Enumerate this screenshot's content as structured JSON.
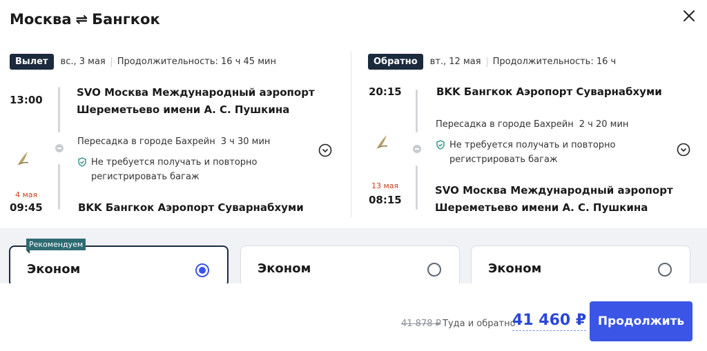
{
  "header": {
    "from": "Москва",
    "arrows": "⇌",
    "to": "Бангкок",
    "close_icon": "close-icon"
  },
  "outbound": {
    "badge": "Вылет",
    "date": "вс., 3 мая",
    "duration": "Продолжительность: 16 ч 45 мин",
    "dep_time": "13:00",
    "dep_airport_line1": "SVO Москва Международный аэропорт",
    "dep_airport_line2": "Шереметьево имени А. С. Пушкина",
    "transfer": "Пересадка в городе Бахрейн",
    "transfer_duration": "3 ч 30 мин",
    "baggage_note_line1": "Не требуется получать и повторно",
    "baggage_note_line2": "регистрировать багаж",
    "arr_date": "4 мая",
    "arr_time": "09:45",
    "arr_airport": "BKK Бангкок Аэропорт Суварнабхуми"
  },
  "return": {
    "badge": "Обратно",
    "date": "вт., 12 мая",
    "duration": "Продолжительность: 16 ч",
    "dep_time": "20:15",
    "dep_airport": "BKK Бангкок Аэропорт Суварнабхуми",
    "transfer": "Пересадка в городе Бахрейн",
    "transfer_duration": "2 ч 20 мин",
    "baggage_note_line1": "Не требуется получать и повторно",
    "baggage_note_line2": "регистрировать багаж",
    "arr_date": "13 мая",
    "arr_time": "08:15",
    "arr_airport_line1": "SVO Москва Международный аэропорт",
    "arr_airport_line2": "Шереметьево имени А. С. Пушкина"
  },
  "fares": {
    "recommend_label": "Рекомендуем",
    "items": [
      {
        "name": "Эконом",
        "selected": true
      },
      {
        "name": "Эконом",
        "selected": false
      },
      {
        "name": "Эконом",
        "selected": false
      }
    ]
  },
  "footer": {
    "old_price": "41 878 ₽",
    "route_type": "Туда и обратно",
    "price": "41 460 ₽",
    "continue_label": "Продолжить"
  },
  "colors": {
    "accent": "#3b55e6",
    "badge": "#1b2a3d",
    "arrival_date": "#c6421c",
    "recommend": "#2f6b73"
  }
}
